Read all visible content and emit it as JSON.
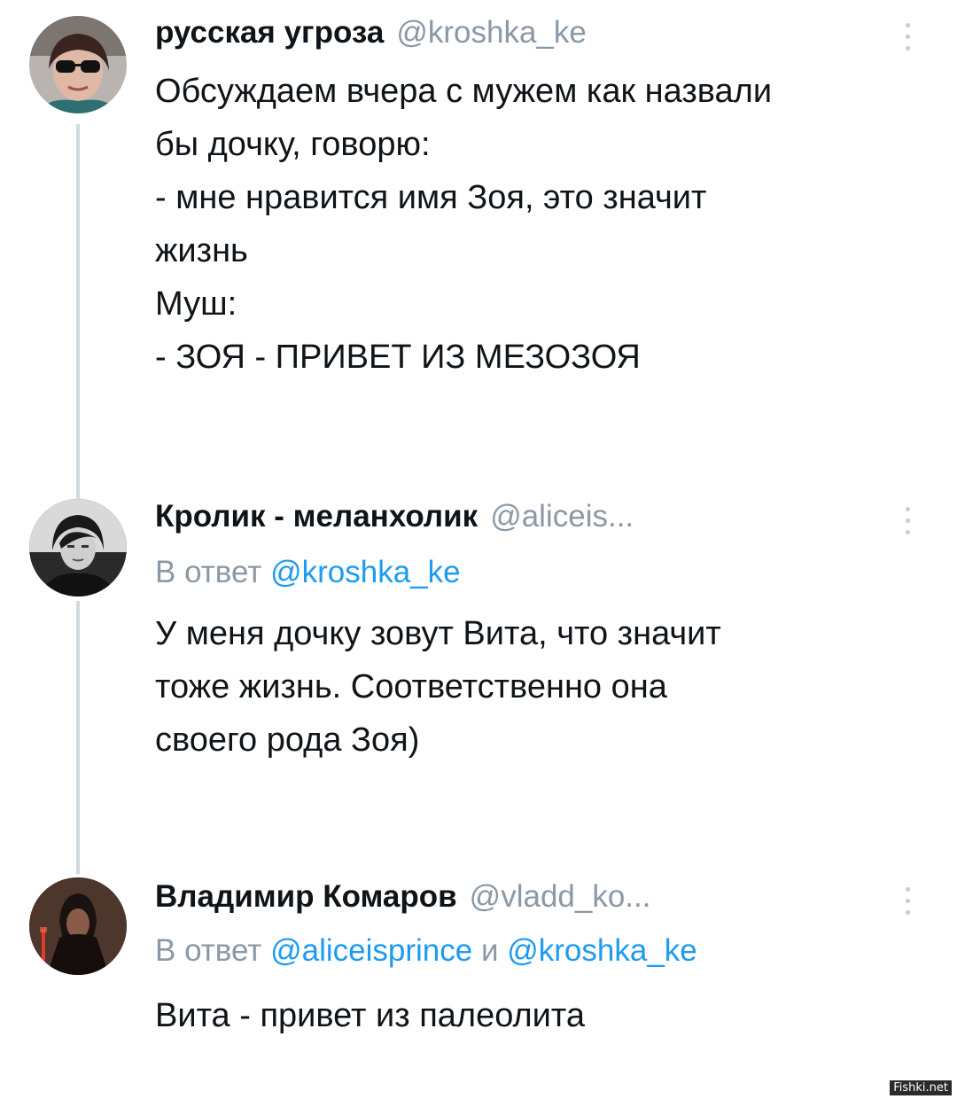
{
  "tweets": [
    {
      "name": "русская угроза",
      "handle": "@kroshka_ke",
      "avatar_icon": "user-avatar-sunglasses",
      "lines": [
        "Обсуждаем вчера с мужем как назвали",
        "бы дочку, говорю:",
        "- мне нравится имя Зоя, это значит",
        "жизнь",
        "Муш:",
        "- ЗОЯ - ПРИВЕТ ИЗ МЕЗОЗОЯ"
      ]
    },
    {
      "name": "Кролик - меланхолик",
      "handle": "@aliceis...",
      "avatar_icon": "user-avatar-portrait-bw",
      "reply_prefix": "В ответ",
      "reply_mention_1": "@kroshka_ke",
      "lines": [
        "У меня дочку зовут Вита, что значит",
        "тоже жизнь. Соответственно она",
        "своего рода Зоя)"
      ]
    },
    {
      "name": "Владимир Комаров",
      "handle": "@vladd_ko...",
      "avatar_icon": "user-avatar-dark-figure",
      "reply_prefix": "В ответ",
      "reply_mention_1": "@aliceisprince",
      "reply_conjunction": "и",
      "reply_mention_2": "@kroshka_ke",
      "lines": [
        "Вита - привет из палеолита"
      ]
    }
  ],
  "watermark": "Fishki.net",
  "colors": {
    "text": "#0f1419",
    "muted": "#8b98a5",
    "mention": "#1d9bf0",
    "thread_line": "#cfd9de"
  }
}
